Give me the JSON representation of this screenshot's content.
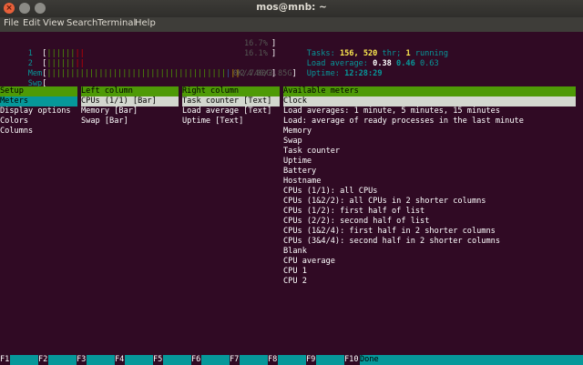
{
  "window": {
    "title": "mos@mnb: ~",
    "close_glyph": "×"
  },
  "menu": [
    "File",
    "Edit",
    "View",
    "Search",
    "Terminal",
    "Help"
  ],
  "meters": {
    "cpu1": {
      "label": "1",
      "bar_green": "||||||",
      "bar_red": "||",
      "value": "16.7%"
    },
    "cpu2": {
      "label": "2",
      "bar_green": "||||||",
      "bar_red": "||",
      "value": "16.1%"
    },
    "mem": {
      "label": "Mem",
      "bar_green": "||||||||||||||||||||||||||||||||||||||",
      "bar_blue": "|",
      "bar_yellow": "||",
      "value": "2.74G/3.85G"
    },
    "swp": {
      "label": "Swp",
      "value": "0K/4.00G"
    }
  },
  "stats": {
    "tasks_label": "Tasks:",
    "tasks": "156,",
    "threads": "520",
    "thr_label": "thr;",
    "running": "1",
    "running_label": "running",
    "load_label": "Load average:",
    "load1": "0.38",
    "load5": "0.46",
    "load15": "0.63",
    "uptime_label": "Uptime:",
    "uptime": "12:28:29"
  },
  "setup": {
    "header": "Setup",
    "items": [
      "Meters",
      "Display options",
      "Colors",
      "Columns"
    ],
    "selected": 0
  },
  "left_column": {
    "header": "Left column",
    "items": [
      "CPUs (1/1) [Bar]",
      "Memory [Bar]",
      "Swap [Bar]"
    ]
  },
  "right_column": {
    "header": "Right column",
    "items": [
      "Task counter [Text]",
      "Load average [Text]",
      "Uptime [Text]"
    ]
  },
  "available_meters": {
    "header": "Available meters",
    "items": [
      "Clock",
      "Load averages: 1 minute, 5 minutes, 15 minutes",
      "Load: average of ready processes in the last minute",
      "Memory",
      "Swap",
      "Task counter",
      "Uptime",
      "Battery",
      "Hostname",
      "CPUs (1/1): all CPUs",
      "CPUs (1&2/2): all CPUs in 2 shorter columns",
      "CPUs (1/2): first half of list",
      "CPUs (2/2): second half of list",
      "CPUs (1&2/4): first half in 2 shorter columns",
      "CPUs (3&4/4): second half in 2 shorter columns",
      "Blank",
      "CPU average",
      "CPU 1",
      "CPU 2"
    ]
  },
  "function_keys": [
    {
      "key": "F1",
      "label": ""
    },
    {
      "key": "F2",
      "label": ""
    },
    {
      "key": "F3",
      "label": ""
    },
    {
      "key": "F4",
      "label": ""
    },
    {
      "key": "F5",
      "label": ""
    },
    {
      "key": "F6",
      "label": ""
    },
    {
      "key": "F7",
      "label": ""
    },
    {
      "key": "F8",
      "label": ""
    },
    {
      "key": "F9",
      "label": ""
    },
    {
      "key": "F10",
      "label": "Done"
    }
  ]
}
